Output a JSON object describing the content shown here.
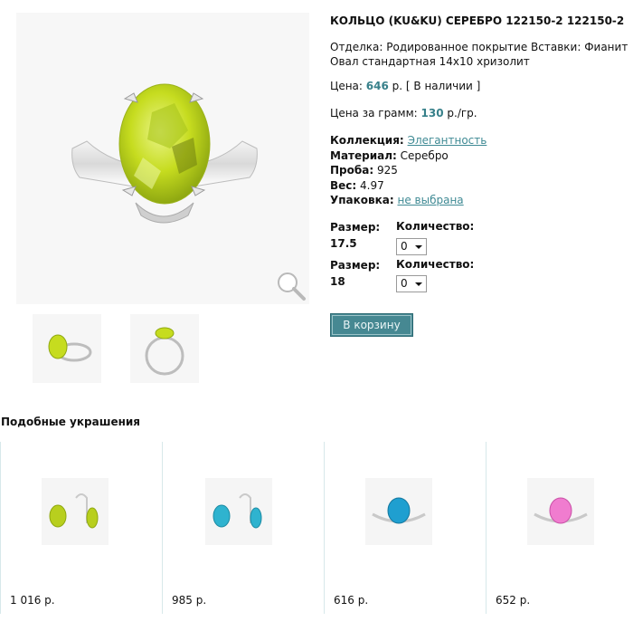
{
  "product": {
    "title": "КОЛЬЦО (KU&KU) СЕРЕБРО 122150-2 122150-2",
    "description": "Отделка: Родированное покрытие Вставки: Фианит Овал стандартная 14x10 хризолит",
    "price_label": "Цена:",
    "price_value": "646",
    "price_suffix": "р. [ В наличии ]",
    "gram_label": "Цена за грамм:",
    "gram_value": "130",
    "gram_suffix": "р./гр.",
    "props": {
      "collection_label": "Коллекция:",
      "collection_value": "Элегантность",
      "material_label": "Материал:",
      "material_value": "Серебро",
      "proba_label": "Проба:",
      "proba_value": "925",
      "weight_label": "Вес:",
      "weight_value": "4.97",
      "package_label": "Упаковка:",
      "package_value": "не выбрана"
    },
    "sizes": [
      {
        "size_label": "Размер:",
        "size_value": "17.5",
        "qty_label": "Количество:",
        "qty_value": "0"
      },
      {
        "size_label": "Размер:",
        "size_value": "18",
        "qty_label": "Количество:",
        "qty_value": "0"
      }
    ],
    "cart_button": "В корзину"
  },
  "similar": {
    "title": "Подобные украшения",
    "items": [
      {
        "price": "1 016 р.",
        "kind": "earrings",
        "stone_color": "#b8cf1e"
      },
      {
        "price": "985 р.",
        "kind": "earrings",
        "stone_color": "#2fb3cf"
      },
      {
        "price": "616 р.",
        "kind": "ring",
        "stone_color": "#1f9fd0"
      },
      {
        "price": "652 р.",
        "kind": "ring",
        "stone_color": "#f07ccf"
      }
    ]
  },
  "colors": {
    "accent": "#37808a",
    "button": "#468892",
    "main_stone": "#c6dc1f"
  }
}
